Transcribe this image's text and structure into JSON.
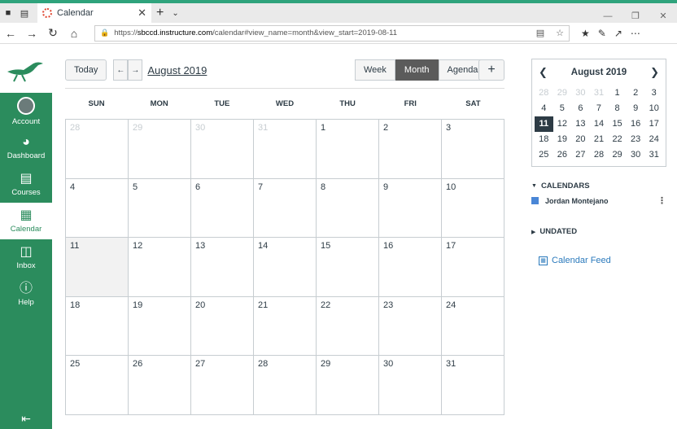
{
  "browser": {
    "tab_title": "Calendar",
    "url_prefix": "https://",
    "url_host": "sbccd.instructure.com",
    "url_rest": "/calendar#view_name=month&view_start=2019-08-11"
  },
  "sidebar": {
    "items": [
      {
        "label": "Account",
        "icon": "avatar"
      },
      {
        "label": "Dashboard",
        "icon": "dashboard-icon"
      },
      {
        "label": "Courses",
        "icon": "courses-icon"
      },
      {
        "label": "Calendar",
        "icon": "calendar-icon"
      },
      {
        "label": "Inbox",
        "icon": "inbox-icon"
      },
      {
        "label": "Help",
        "icon": "help-icon"
      }
    ]
  },
  "toolbar": {
    "today": "Today",
    "month_title": "August 2019",
    "views": [
      "Week",
      "Month",
      "Agenda"
    ],
    "active_view": "Month"
  },
  "calendar": {
    "weekdays": [
      "SUN",
      "MON",
      "TUE",
      "WED",
      "THU",
      "FRI",
      "SAT"
    ],
    "weeks": [
      [
        "28",
        "29",
        "30",
        "31",
        "1",
        "2",
        "3"
      ],
      [
        "4",
        "5",
        "6",
        "7",
        "8",
        "9",
        "10"
      ],
      [
        "11",
        "12",
        "13",
        "14",
        "15",
        "16",
        "17"
      ],
      [
        "18",
        "19",
        "20",
        "21",
        "22",
        "23",
        "24"
      ],
      [
        "25",
        "26",
        "27",
        "28",
        "29",
        "30",
        "31"
      ]
    ],
    "other_month_first_row": 4,
    "today": "11"
  },
  "mini_calendar": {
    "title": "August 2019",
    "days": [
      "28",
      "29",
      "30",
      "31",
      "1",
      "2",
      "3",
      "4",
      "5",
      "6",
      "7",
      "8",
      "9",
      "10",
      "11",
      "12",
      "13",
      "14",
      "15",
      "16",
      "17",
      "18",
      "19",
      "20",
      "21",
      "22",
      "23",
      "24",
      "25",
      "26",
      "27",
      "28",
      "29",
      "30",
      "31"
    ]
  },
  "calendars_section": {
    "title": "CALENDARS",
    "items": [
      {
        "name": "Jordan Montejano",
        "color": "#4a86d6"
      }
    ]
  },
  "undated_section": {
    "title": "UNDATED"
  },
  "feed_link": "Calendar Feed"
}
